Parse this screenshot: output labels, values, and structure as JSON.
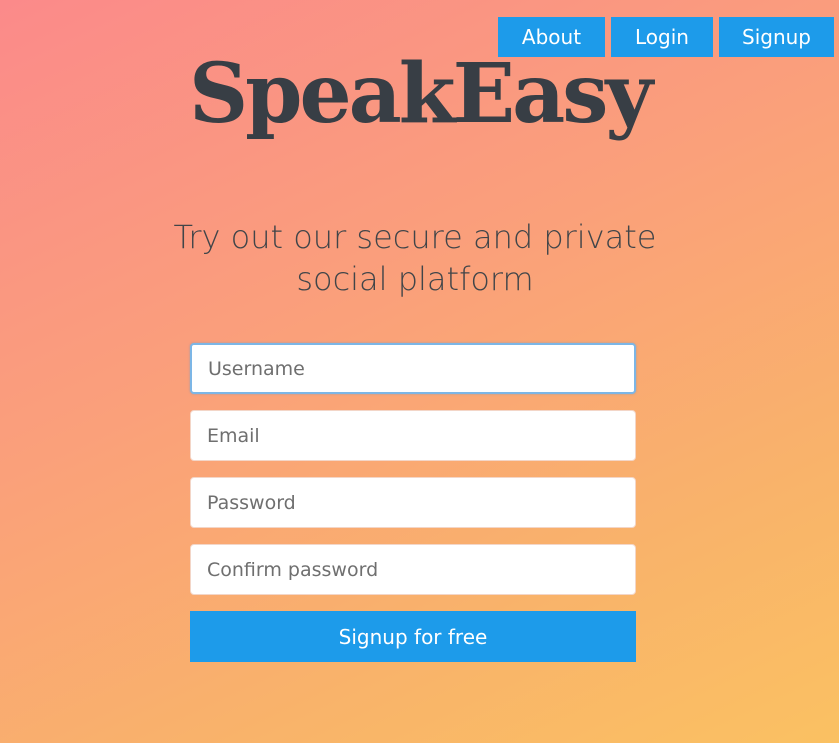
{
  "nav": {
    "about_label": "About",
    "login_label": "Login",
    "signup_label": "Signup"
  },
  "brand": {
    "logo_text": "SpeakEasy"
  },
  "tagline": "Try out our secure and private social platform",
  "form": {
    "username_placeholder": "Username",
    "email_placeholder": "Email",
    "password_placeholder": "Password",
    "confirm_placeholder": "Confirm password",
    "submit_label": "Signup for free"
  },
  "colors": {
    "accent": "#1d9bea",
    "logo": "#383e45",
    "gradient_start": "#fb8a8a",
    "gradient_end": "#fac162"
  }
}
